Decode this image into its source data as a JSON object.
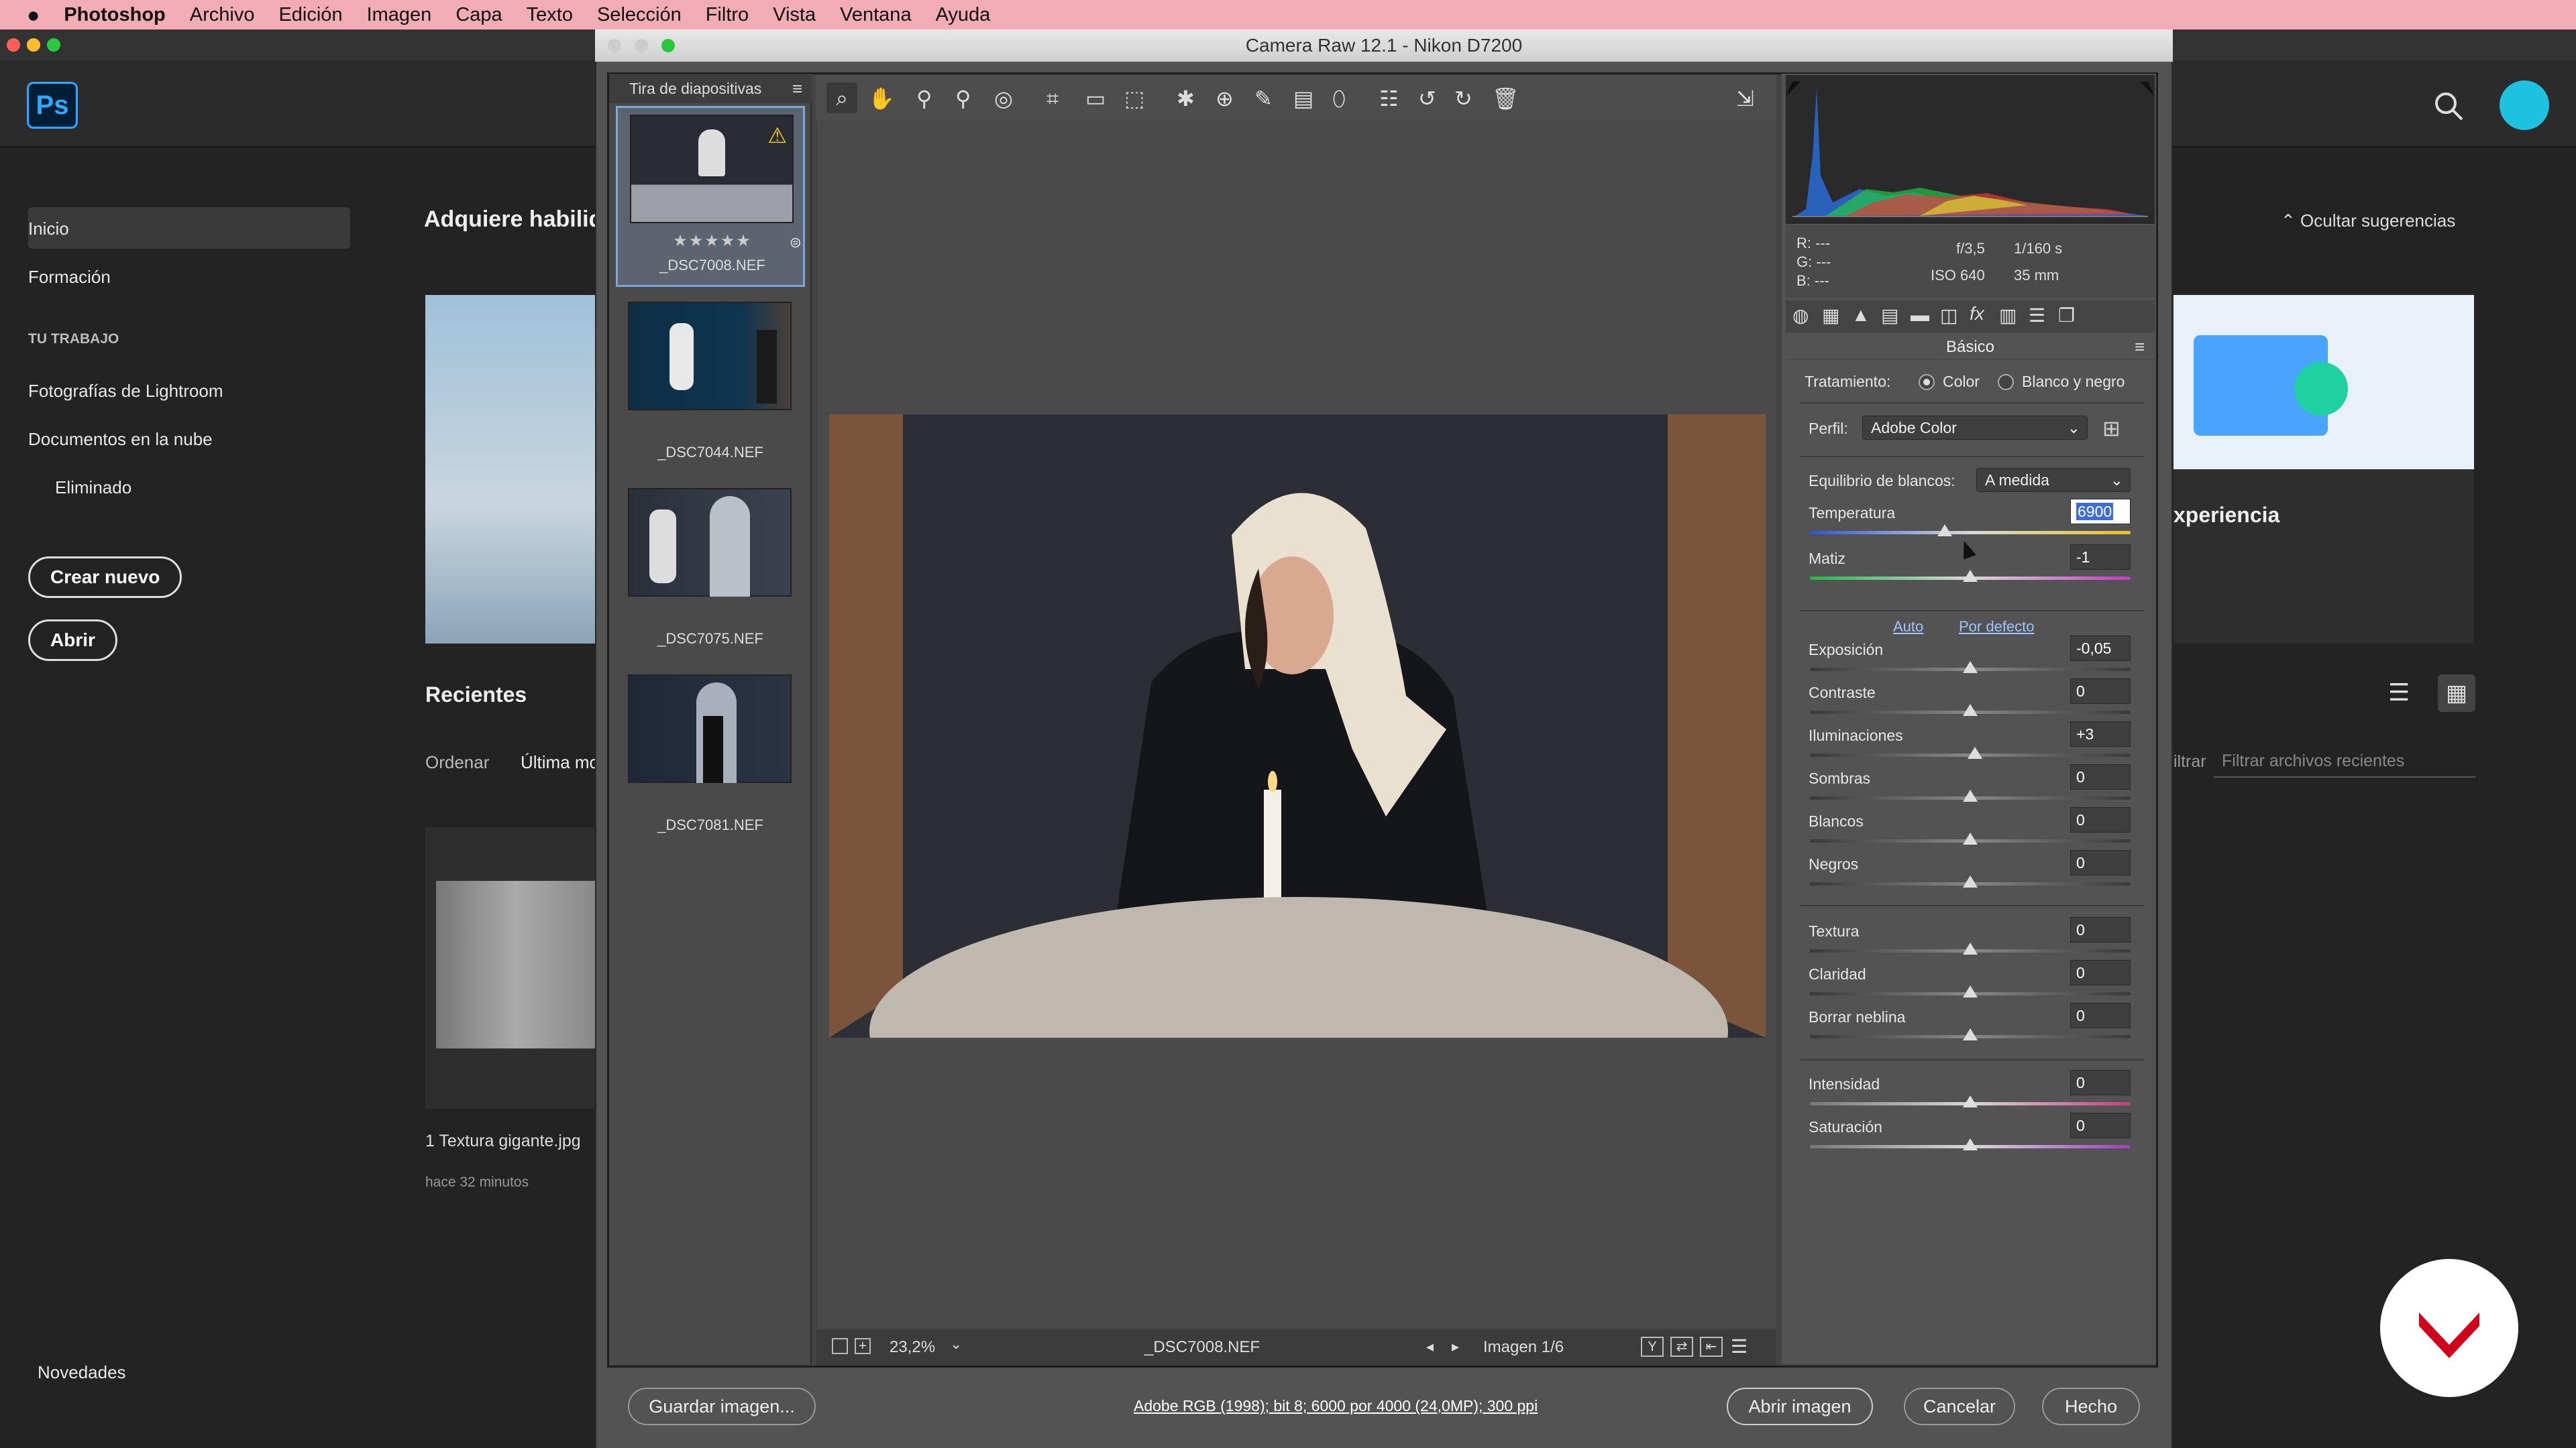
{
  "menubar": {
    "app": "Photoshop",
    "items": [
      "Archivo",
      "Edición",
      "Imagen",
      "Capa",
      "Texto",
      "Selección",
      "Filtro",
      "Vista",
      "Ventana",
      "Ayuda"
    ]
  },
  "ps_home": {
    "logo": "Ps",
    "sidebar": {
      "inicio": "Inicio",
      "formacion": "Formación",
      "section": "TU TRABAJO",
      "lightroom": "Fotografías de Lightroom",
      "cloud_docs": "Documentos en la nube",
      "deleted": "Eliminado",
      "create_new": "Crear nuevo",
      "open": "Abrir",
      "news": "Novedades"
    },
    "main": {
      "headline": "Adquiere habilid",
      "recent_title": "Recientes",
      "sort_label": "Ordenar",
      "sort_value": "Última mo",
      "recent_file": "1 Textura gigante.jpg",
      "recent_time": "hace 32 minutos",
      "hide_suggestions": "Ocultar sugerencias",
      "experience_text": "xperiencia",
      "filter_label": "iltrar",
      "filter_placeholder": "Filtrar archivos recientes"
    }
  },
  "dialog": {
    "title": "Camera Raw 12.1 -  Nikon D7200",
    "filmstrip": {
      "header": "Tira de diapositivas",
      "items": [
        {
          "name": "_DSC7008.NEF",
          "stars": "★★★★★"
        },
        {
          "name": "_DSC7044.NEF"
        },
        {
          "name": "_DSC7075.NEF"
        },
        {
          "name": "_DSC7081.NEF"
        }
      ]
    },
    "status": {
      "zoom": "23,2%",
      "filename": "_DSC7008.NEF",
      "image_count": "Imagen 1/6"
    },
    "info": {
      "r": "R:  ---",
      "g": "G:  ---",
      "b": "B:  ---",
      "aperture": "f/3,5",
      "shutter": "1/160 s",
      "iso": "ISO 640",
      "focal": "35 mm"
    },
    "panel": {
      "title": "Básico",
      "treatment_label": "Tratamiento:",
      "treatment_color": "Color",
      "treatment_bw": "Blanco y negro",
      "profile_label": "Perfil:",
      "profile_value": "Adobe Color",
      "wb_label": "Equilibrio de blancos:",
      "wb_value": "A medida",
      "auto": "Auto",
      "default": "Por defecto",
      "sliders": [
        {
          "label": "Temperatura",
          "value": "6900",
          "pos": 0.42
        },
        {
          "label": "Matiz",
          "value": "-1",
          "pos": 0.5
        },
        {
          "label": "Exposición",
          "value": "-0,05",
          "pos": 0.5
        },
        {
          "label": "Contraste",
          "value": "0",
          "pos": 0.5
        },
        {
          "label": "Iluminaciones",
          "value": "+3",
          "pos": 0.515
        },
        {
          "label": "Sombras",
          "value": "0",
          "pos": 0.5
        },
        {
          "label": "Blancos",
          "value": "0",
          "pos": 0.5
        },
        {
          "label": "Negros",
          "value": "0",
          "pos": 0.5
        },
        {
          "label": "Textura",
          "value": "0",
          "pos": 0.5
        },
        {
          "label": "Claridad",
          "value": "0",
          "pos": 0.5
        },
        {
          "label": "Borrar neblina",
          "value": "0",
          "pos": 0.5
        },
        {
          "label": "Intensidad",
          "value": "0",
          "pos": 0.5
        },
        {
          "label": "Saturación",
          "value": "0",
          "pos": 0.5
        }
      ]
    },
    "buttons": {
      "save": "Guardar imagen...",
      "workflow": "Adobe RGB (1998); bit 8; 6000 por 4000 (24,0MP); 300 ppi",
      "open": "Abrir imagen",
      "cancel": "Cancelar",
      "done": "Hecho"
    }
  }
}
